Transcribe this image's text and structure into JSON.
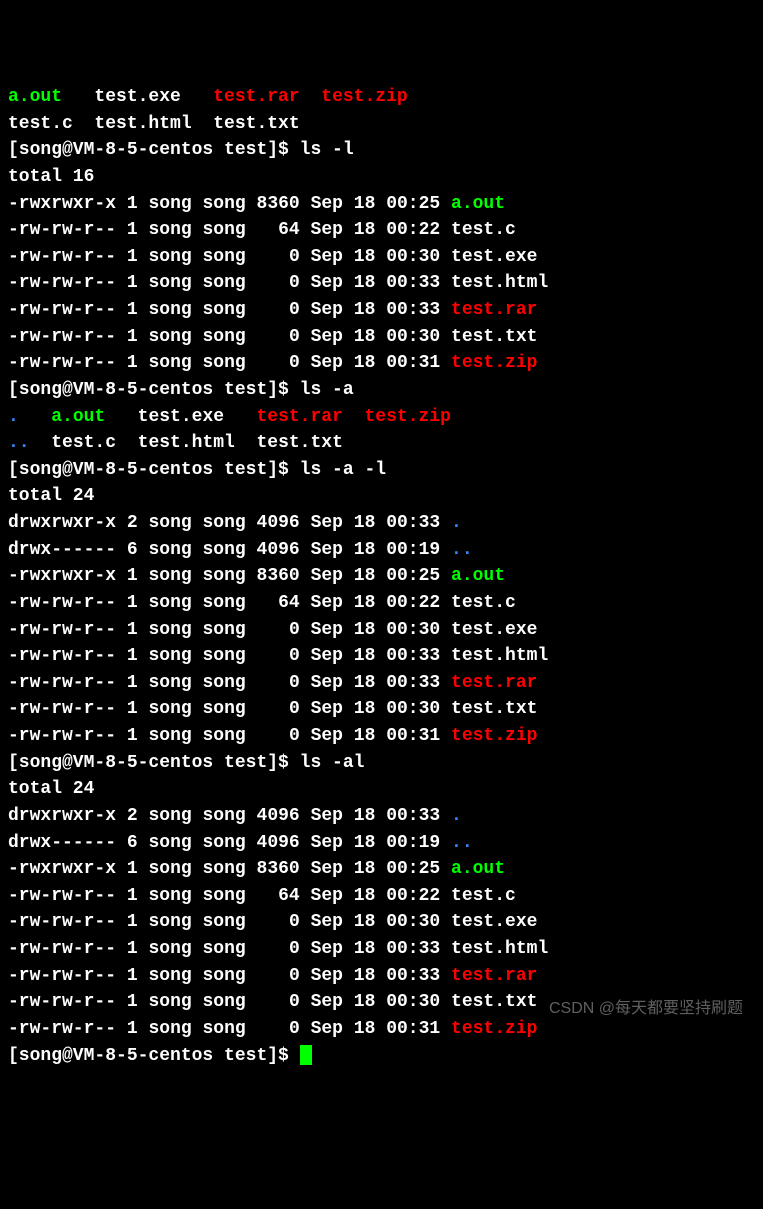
{
  "prompt": "[song@VM-8-5-centos test]$ ",
  "cmd_ls_l": "ls -l",
  "cmd_ls_a": "ls -a",
  "cmd_ls_a_l": "ls -a -l",
  "cmd_ls_al": "ls -al",
  "total_16": "total 16",
  "total_24": "total 24",
  "short_row1": {
    "aout": "a.out",
    "testexe": "test.exe",
    "testrar": "test.rar",
    "testzip": "test.zip"
  },
  "short_row2": {
    "testc": "test.c",
    "testhtml": "test.html",
    "testtxt": "test.txt"
  },
  "short_a_row1": {
    "dot": ".",
    "aout": "a.out",
    "testexe": "test.exe",
    "testrar": "test.rar",
    "testzip": "test.zip"
  },
  "short_a_row2": {
    "dotdot": "..",
    "testc": "test.c",
    "testhtml": "test.html",
    "testtxt": "test.txt"
  },
  "files": {
    "dot": {
      "perm": "drwxrwxr-x",
      "links": "2",
      "owner": "song",
      "group": "song",
      "size": "4096",
      "month": "Sep",
      "day": "18",
      "time": "00:33",
      "name": "."
    },
    "dotdot": {
      "perm": "drwx------",
      "links": "6",
      "owner": "song",
      "group": "song",
      "size": "4096",
      "month": "Sep",
      "day": "18",
      "time": "00:19",
      "name": ".."
    },
    "aout": {
      "perm": "-rwxrwxr-x",
      "links": "1",
      "owner": "song",
      "group": "song",
      "size": "8360",
      "month": "Sep",
      "day": "18",
      "time": "00:25",
      "name": "a.out"
    },
    "testc": {
      "perm": "-rw-rw-r--",
      "links": "1",
      "owner": "song",
      "group": "song",
      "size": "64",
      "month": "Sep",
      "day": "18",
      "time": "00:22",
      "name": "test.c"
    },
    "testexe": {
      "perm": "-rw-rw-r--",
      "links": "1",
      "owner": "song",
      "group": "song",
      "size": "0",
      "month": "Sep",
      "day": "18",
      "time": "00:30",
      "name": "test.exe"
    },
    "testhtml": {
      "perm": "-rw-rw-r--",
      "links": "1",
      "owner": "song",
      "group": "song",
      "size": "0",
      "month": "Sep",
      "day": "18",
      "time": "00:33",
      "name": "test.html"
    },
    "testrar": {
      "perm": "-rw-rw-r--",
      "links": "1",
      "owner": "song",
      "group": "song",
      "size": "0",
      "month": "Sep",
      "day": "18",
      "time": "00:33",
      "name": "test.rar"
    },
    "testtxt": {
      "perm": "-rw-rw-r--",
      "links": "1",
      "owner": "song",
      "group": "song",
      "size": "0",
      "month": "Sep",
      "day": "18",
      "time": "00:30",
      "name": "test.txt"
    },
    "testzip": {
      "perm": "-rw-rw-r--",
      "links": "1",
      "owner": "song",
      "group": "song",
      "size": "0",
      "month": "Sep",
      "day": "18",
      "time": "00:31",
      "name": "test.zip"
    }
  },
  "watermark": "CSDN @每天都要坚持刷题"
}
